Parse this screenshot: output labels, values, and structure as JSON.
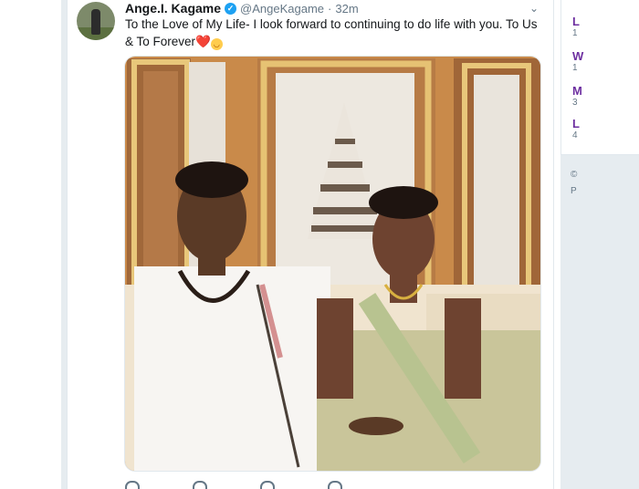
{
  "tweet": {
    "author_name": "Ange.I. Kagame",
    "verified_mark": "✓",
    "handle": "@AngeKagame",
    "separator": "·",
    "time": "32m",
    "text_main": "To the Love of My Life- I look forward to continuing to do life with you. To Us & To Forever",
    "heart_emoji": "❤️",
    "smile_emoji": "😊",
    "caret": "⌄",
    "image_icon": "photo"
  },
  "sidebar": {
    "items": [
      {
        "letter": "L",
        "count": "1"
      },
      {
        "letter": "W",
        "count": "1"
      },
      {
        "letter": "M",
        "count": "3"
      },
      {
        "letter": "L",
        "count": "4"
      }
    ],
    "footer_copyright": "©",
    "footer_letter": "P"
  },
  "colors": {
    "accent": "#1da1f2",
    "link_purple": "#6d2fa0",
    "heart": "#e0245e"
  }
}
